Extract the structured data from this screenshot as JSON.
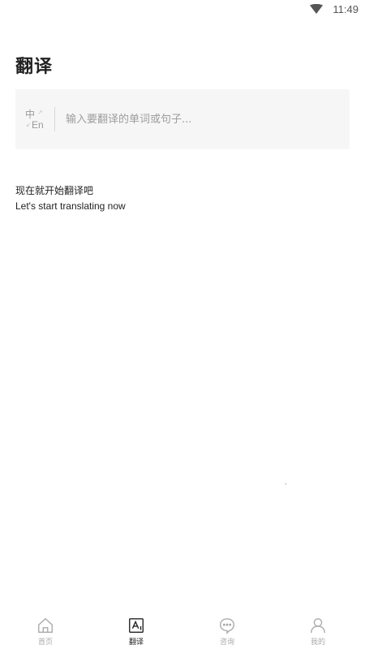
{
  "status_bar": {
    "time": "11:49"
  },
  "header": {
    "title": "翻译"
  },
  "input": {
    "lang_from": "中",
    "lang_to": "En",
    "placeholder": "输入要翻译的单词或句子..."
  },
  "prompt": {
    "cn": "现在就开始翻译吧",
    "en": "Let's start translating now"
  },
  "bottom_nav": {
    "items": [
      {
        "label": "首页",
        "icon": "home-icon",
        "active": false
      },
      {
        "label": "翻译",
        "icon": "translate-icon",
        "active": true
      },
      {
        "label": "咨询",
        "icon": "chat-icon",
        "active": false
      },
      {
        "label": "我的",
        "icon": "user-icon",
        "active": false
      }
    ]
  },
  "colors": {
    "active": "#222222",
    "inactive": "#aaaaaa",
    "input_bg": "#f6f6f6"
  }
}
